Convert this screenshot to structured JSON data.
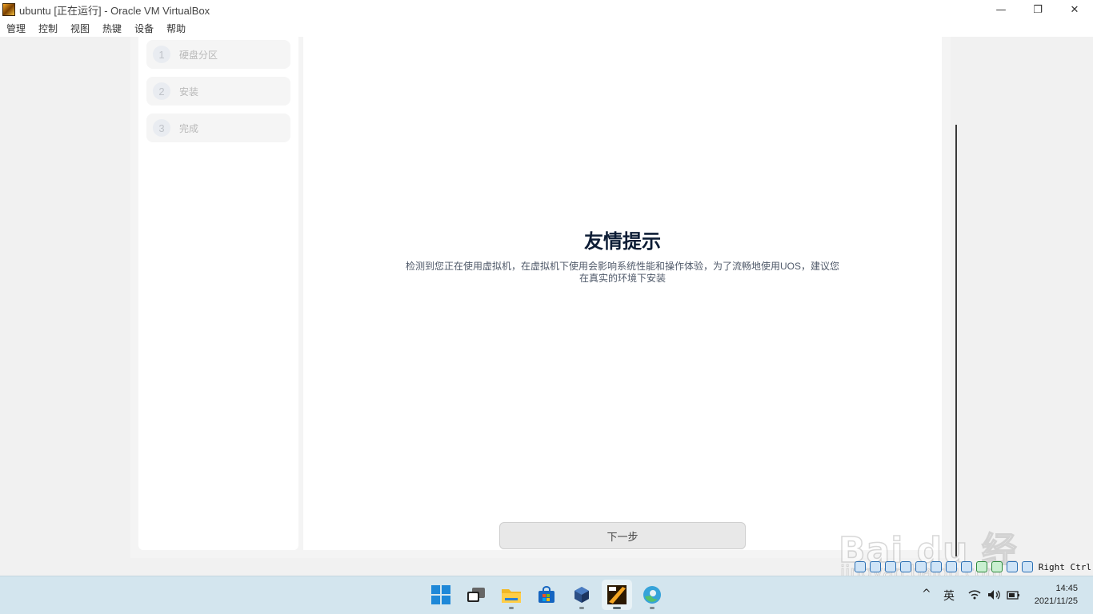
{
  "window": {
    "title": "ubuntu [正在运行] - Oracle VM VirtualBox",
    "minimize": "—",
    "maximize": "❐",
    "close": "✕"
  },
  "menu": [
    "管理",
    "控制",
    "视图",
    "热键",
    "设备",
    "帮助"
  ],
  "installer": {
    "steps": [
      {
        "num": "1",
        "label": "硬盘分区"
      },
      {
        "num": "2",
        "label": "安装"
      },
      {
        "num": "3",
        "label": "完成"
      }
    ],
    "notice_title": "友情提示",
    "notice_body": "检测到您正在使用虚拟机，在虚拟机下使用会影响系统性能和操作体验，为了流畅地使用UOS，建议您在真实的环境下安装",
    "next_button": "下一步"
  },
  "vbox_status": {
    "host_key": "Right Ctrl",
    "icons": [
      "hard-disk-icon",
      "optical-drive-icon",
      "audio-icon",
      "network-icon",
      "usb-icon",
      "shared-folder-icon",
      "display-icon",
      "video-capture-icon",
      "cpu-icon",
      "mouse-integration-icon",
      "keyboard-icon",
      "host-key-icon"
    ]
  },
  "taskbar": {
    "apps": [
      "start",
      "task-view",
      "file-explorer",
      "microsoft-store",
      "virtualbox",
      "ubuntu-vm",
      "edge-browser"
    ],
    "ime": "英",
    "chevron": "^",
    "time": "14:45",
    "date": "2021/11/25"
  },
  "watermark": {
    "main": "Bai du 经验",
    "sub": "jingyan.baidu.com"
  }
}
